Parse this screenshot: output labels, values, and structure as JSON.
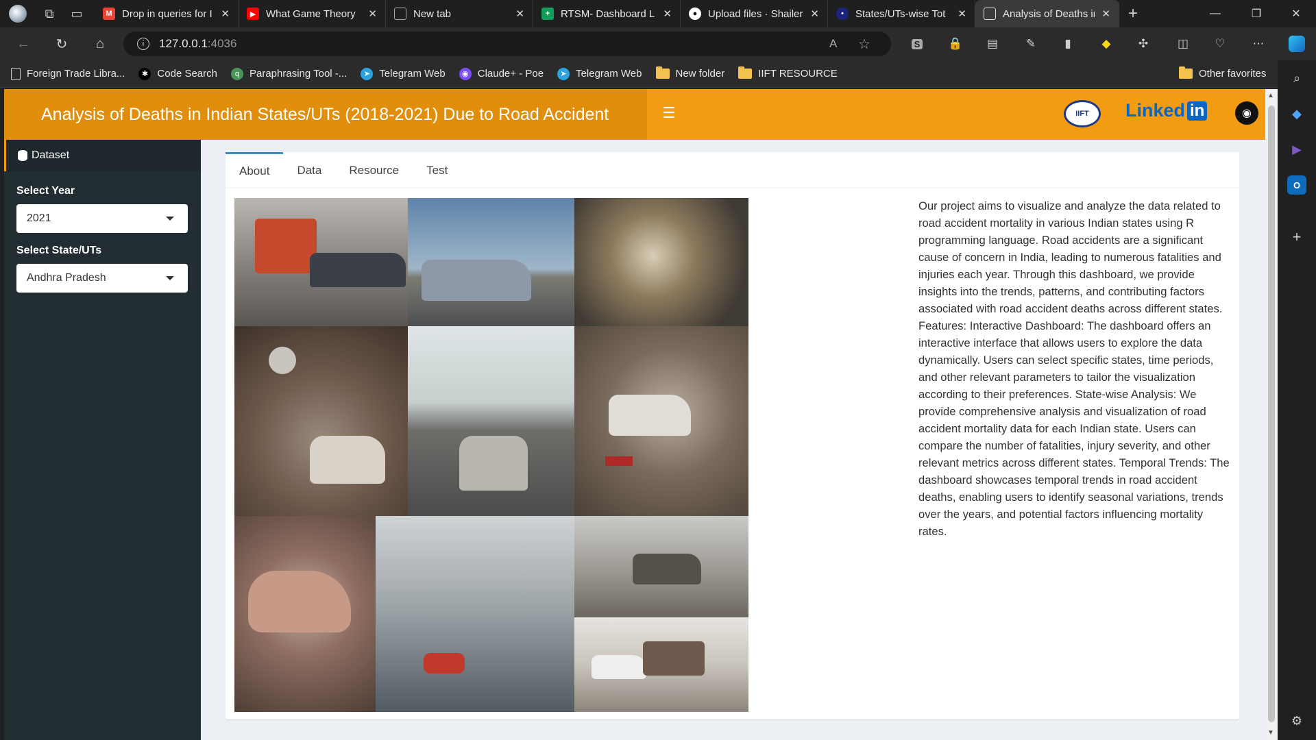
{
  "browser": {
    "tabs": [
      {
        "title": "Drop in queries for I",
        "icon": "gmail-icon",
        "color": "#ea4335"
      },
      {
        "title": "What Game Theory",
        "icon": "youtube-icon",
        "color": "#ff0000"
      },
      {
        "title": "New tab",
        "icon": "newtab-icon",
        "color": "#5f6368"
      },
      {
        "title": "RTSM- Dashboard L",
        "icon": "sheets-icon",
        "color": "#0f9d58"
      },
      {
        "title": "Upload files · Shailer",
        "icon": "github-icon",
        "color": "#ffffff"
      },
      {
        "title": "States/UTs-wise Tot",
        "icon": "site-icon",
        "color": "#1a237e"
      },
      {
        "title": "Analysis of Deaths in",
        "icon": "page-icon",
        "color": "#5f6368"
      }
    ],
    "close_glyph": "✕",
    "new_tab_glyph": "+",
    "address": {
      "host": "127.0.0.1",
      "port": ":4036"
    },
    "bookmarks": [
      {
        "label": "Foreign Trade Libra...",
        "icon": "page-icon"
      },
      {
        "label": "Code Search",
        "icon": "code-search-icon"
      },
      {
        "label": "Paraphrasing Tool -...",
        "icon": "quillbot-icon"
      },
      {
        "label": "Telegram Web",
        "icon": "telegram-icon"
      },
      {
        "label": "Claude+ - Poe",
        "icon": "poe-icon"
      },
      {
        "label": "Telegram Web",
        "icon": "telegram-icon"
      },
      {
        "label": "New folder",
        "icon": "folder-icon"
      },
      {
        "label": "IIFT RESOURCE",
        "icon": "folder-icon"
      }
    ],
    "other_favorites": "Other favorites"
  },
  "app": {
    "title": "Analysis of Deaths in Indian States/UTs (2018-2021) Due to Road Accident",
    "iift_logo": "IIFT",
    "linkedin_text": "Linked",
    "linkedin_in": "in",
    "sidebar": {
      "menu_item": "Dataset",
      "year_label": "Select Year",
      "year_value": "2021",
      "state_label": "Select State/UTs",
      "state_value": "Andhra Pradesh"
    },
    "tabs": [
      "About",
      "Data",
      "Resource",
      "Test"
    ],
    "active_tab": "About",
    "about_text": "Our project aims to visualize and analyze the data related to road accident mortality in various Indian states using R programming language. Road accidents are a significant cause of concern in India, leading to numerous fatalities and injuries each year. Through this dashboard, we provide insights into the trends, patterns, and contributing factors associated with road accident deaths across different states. Features: Interactive Dashboard: The dashboard offers an interactive interface that allows users to explore the data dynamically. Users can select specific states, time periods, and other relevant parameters to tailor the visualization according to their preferences. State-wise Analysis: We provide comprehensive analysis and visualization of road accident mortality data for each Indian state. Users can compare the number of fatalities, injury severity, and other relevant metrics across different states. Temporal Trends: The dashboard showcases temporal trends in road accident deaths, enabling users to identify seasonal variations, trends over the years, and potential factors influencing mortality rates."
  },
  "colors": {
    "header_dark": "#e08e0b",
    "header": "#f39c12",
    "sidebar": "#222d32",
    "tab_active": "#3c8dbc"
  }
}
